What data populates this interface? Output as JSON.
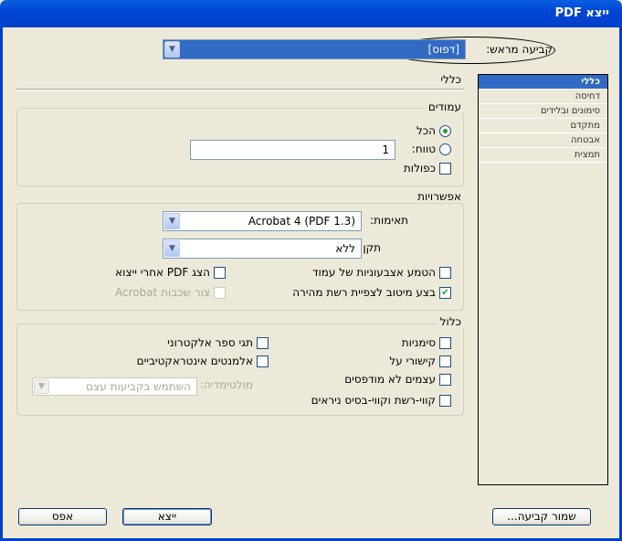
{
  "window": {
    "title": "ייצא PDF"
  },
  "preset": {
    "label": "קביעה מראש:",
    "value": "[דפוס]"
  },
  "section_title": "כללי",
  "sidebar": {
    "items": [
      {
        "label": "כללי"
      },
      {
        "label": "דחיסה"
      },
      {
        "label": "סימונים ובלידים"
      },
      {
        "label": "מתקדם"
      },
      {
        "label": "אבטחה"
      },
      {
        "label": "תמצית"
      }
    ]
  },
  "pages": {
    "title": "עמודים",
    "all": "הכל",
    "range": "טווח:",
    "range_value": "1",
    "spreads": "כפולות"
  },
  "options": {
    "title": "אפשרויות",
    "compat_label": "תאימות:",
    "compat_value": "Acrobat 4 (PDF 1.3)",
    "standard_label": "תקן:",
    "standard_value": "ללא",
    "embed_thumbs": "הטמע אצבעוניות של עמוד",
    "optimize": "בצע מיטוב לצפיית רשת מהירה",
    "view_pdf": "הצג PDF אחרי ייצוא",
    "acrobat_layers": "צור שכבות Acrobat"
  },
  "include": {
    "title": "כלול",
    "bookmarks": "סימניות",
    "hyperlinks": "קישורי על",
    "nonprinting": "עצמים לא מודפסים",
    "guides": "קווי-רשת וקווי-בסיס ניראים",
    "ebook_tags": "תגי ספר אלקטרוני",
    "interactive": "אלמנטים אינטראקטיביים",
    "multimedia_label": "מולטימדיה:",
    "multimedia_value": "השתמש בקביעות עצם"
  },
  "buttons": {
    "reset": "אפס",
    "export": "ייצא",
    "save_preset": "שמור קביעה..."
  }
}
